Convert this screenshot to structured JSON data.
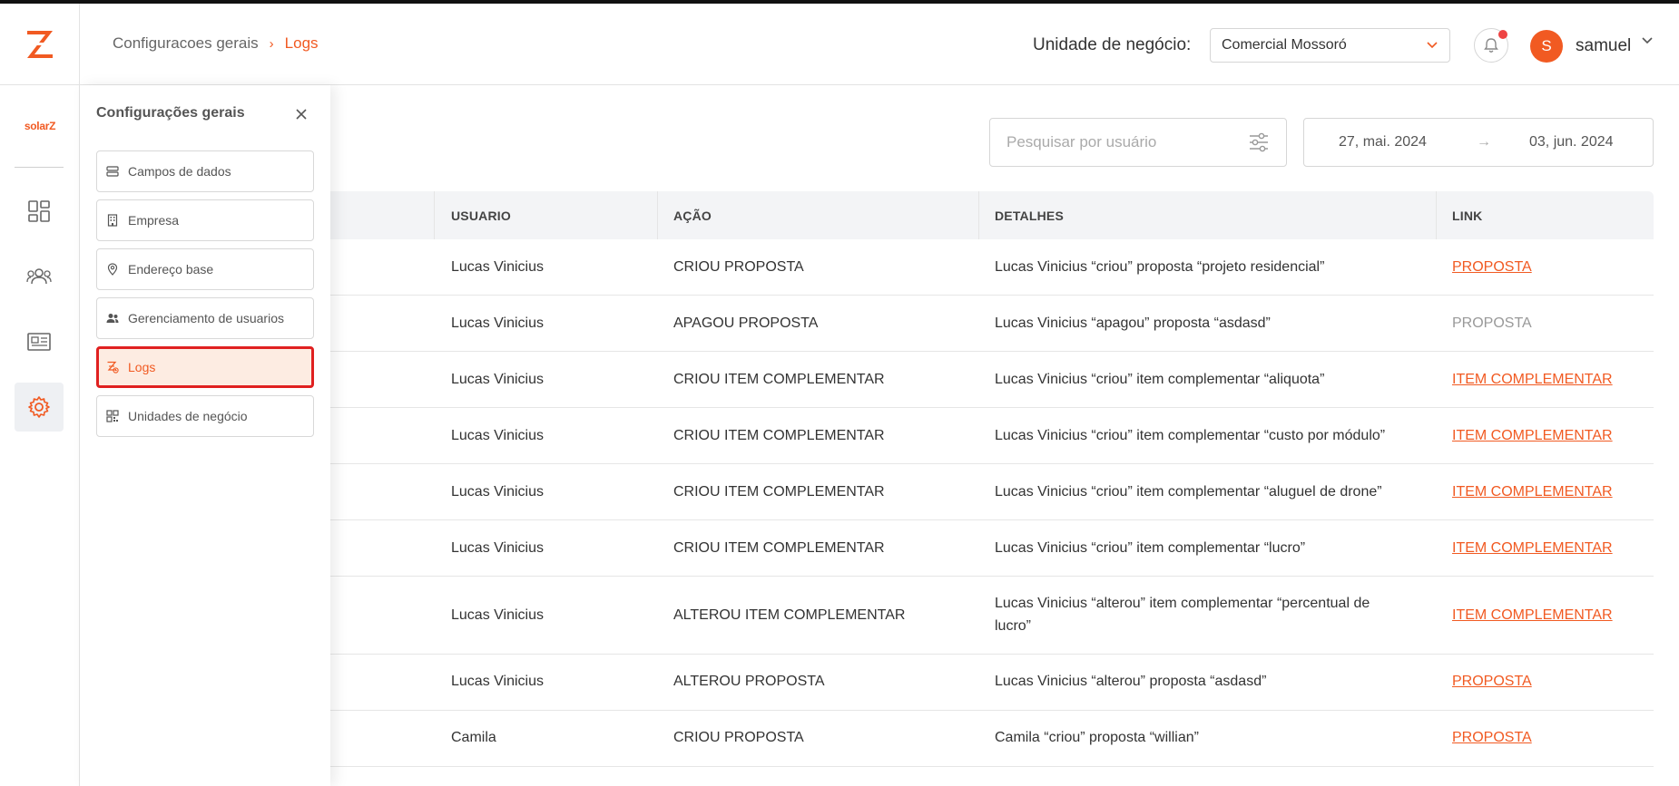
{
  "colors": {
    "brand": "#F15A22",
    "danger": "#e02020"
  },
  "header": {
    "crumbs": [
      "Configuracoes gerais",
      "Logs"
    ],
    "crumb_separator": "›",
    "business_unit_label": "Unidade de negócio:",
    "business_unit_value": "Comercial Mossoró",
    "user_initial": "S",
    "user_name": "samuel"
  },
  "leftnav": {
    "brand_text": "solarZ",
    "items": [
      "dashboard-icon",
      "users-group-icon",
      "newspaper-icon",
      "settings-icon"
    ],
    "active_item": "settings-icon"
  },
  "panel": {
    "title": "Configurações gerais",
    "items": [
      {
        "label": "Campos de dados",
        "icon": "stack-icon"
      },
      {
        "label": "Empresa",
        "icon": "building-icon"
      },
      {
        "label": "Endereço base",
        "icon": "location-pin-icon"
      },
      {
        "label": "Gerenciamento de usuarios",
        "icon": "users-icon"
      },
      {
        "label": "Logs",
        "icon": "logs-icon",
        "active": true
      },
      {
        "label": "Unidades de negócio",
        "icon": "grid-icon"
      }
    ]
  },
  "filters": {
    "search_placeholder": "Pesquisar por usuário",
    "date_from": "27, mai. 2024",
    "date_arrow": "→",
    "date_to": "03, jun. 2024"
  },
  "table": {
    "headers": [
      "USUARIO",
      "AÇÃO",
      "DETALHES",
      "LINK"
    ],
    "rows": [
      {
        "user": "Lucas Vinicius",
        "action": "CRIOU PROPOSTA",
        "details": "Lucas Vinicius “criou” proposta “projeto residencial”",
        "link": "PROPOSTA",
        "link_enabled": true
      },
      {
        "user": "Lucas Vinicius",
        "action": "APAGOU PROPOSTA",
        "details": "Lucas Vinicius “apagou” proposta “asdasd”",
        "link": "PROPOSTA",
        "link_enabled": false
      },
      {
        "user": "Lucas Vinicius",
        "action": "CRIOU ITEM COMPLEMENTAR",
        "details": "Lucas Vinicius “criou” item complementar “aliquota”",
        "link": "ITEM COMPLEMENTAR",
        "link_enabled": true
      },
      {
        "user": "Lucas Vinicius",
        "action": "CRIOU ITEM COMPLEMENTAR",
        "details": "Lucas Vinicius “criou” item complementar “custo por módulo”",
        "link": "ITEM COMPLEMENTAR",
        "link_enabled": true
      },
      {
        "user": "Lucas Vinicius",
        "action": "CRIOU ITEM COMPLEMENTAR",
        "details": "Lucas Vinicius “criou” item complementar “aluguel de drone”",
        "link": "ITEM COMPLEMENTAR",
        "link_enabled": true
      },
      {
        "user": "Lucas Vinicius",
        "action": "CRIOU ITEM COMPLEMENTAR",
        "details": "Lucas Vinicius “criou” item complementar “lucro”",
        "link": "ITEM COMPLEMENTAR",
        "link_enabled": true
      },
      {
        "user": "Lucas Vinicius",
        "action": "ALTEROU ITEM COMPLEMENTAR",
        "details": "Lucas Vinicius “alterou” item complementar “percentual de lucro”",
        "link": "ITEM COMPLEMENTAR",
        "link_enabled": true
      },
      {
        "user": "Lucas Vinicius",
        "action": "ALTEROU PROPOSTA",
        "details": "Lucas Vinicius “alterou” proposta “asdasd”",
        "link": "PROPOSTA",
        "link_enabled": true
      },
      {
        "user": "Camila",
        "action": "CRIOU PROPOSTA",
        "details": "Camila “criou” proposta “willian”",
        "link": "PROPOSTA",
        "link_enabled": true
      }
    ]
  }
}
